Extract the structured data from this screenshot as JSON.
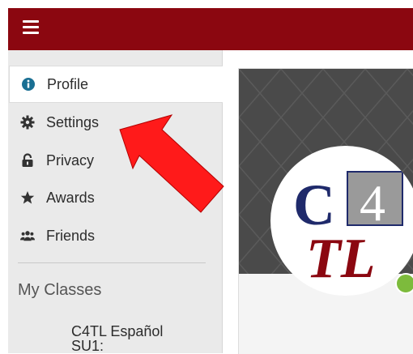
{
  "header": {
    "menu_icon": "hamburger-menu-icon",
    "color": "#8b0710"
  },
  "sidebar": {
    "items": [
      {
        "label": "Profile",
        "icon": "info-circle-icon",
        "active": true
      },
      {
        "label": "Settings",
        "icon": "gear-icon",
        "active": false
      },
      {
        "label": "Privacy",
        "icon": "lock-icon",
        "active": false
      },
      {
        "label": "Awards",
        "icon": "star-icon",
        "active": false
      },
      {
        "label": "Friends",
        "icon": "users-icon",
        "active": false
      }
    ],
    "section_title": "My Classes",
    "classes": [
      {
        "label": "C4TL Español SU1:"
      }
    ]
  },
  "profile": {
    "logo_text_top": "C",
    "logo_text_box": "4",
    "logo_text_bottom": "TL",
    "status": "online",
    "status_color": "#7dbb3c"
  },
  "annotation": {
    "arrow_color": "#ff1a1a",
    "points_to": "Settings"
  },
  "colors": {
    "brand": "#8b0710",
    "sidebar_bg": "#eaeaea",
    "info_blue": "#1a6f93"
  }
}
